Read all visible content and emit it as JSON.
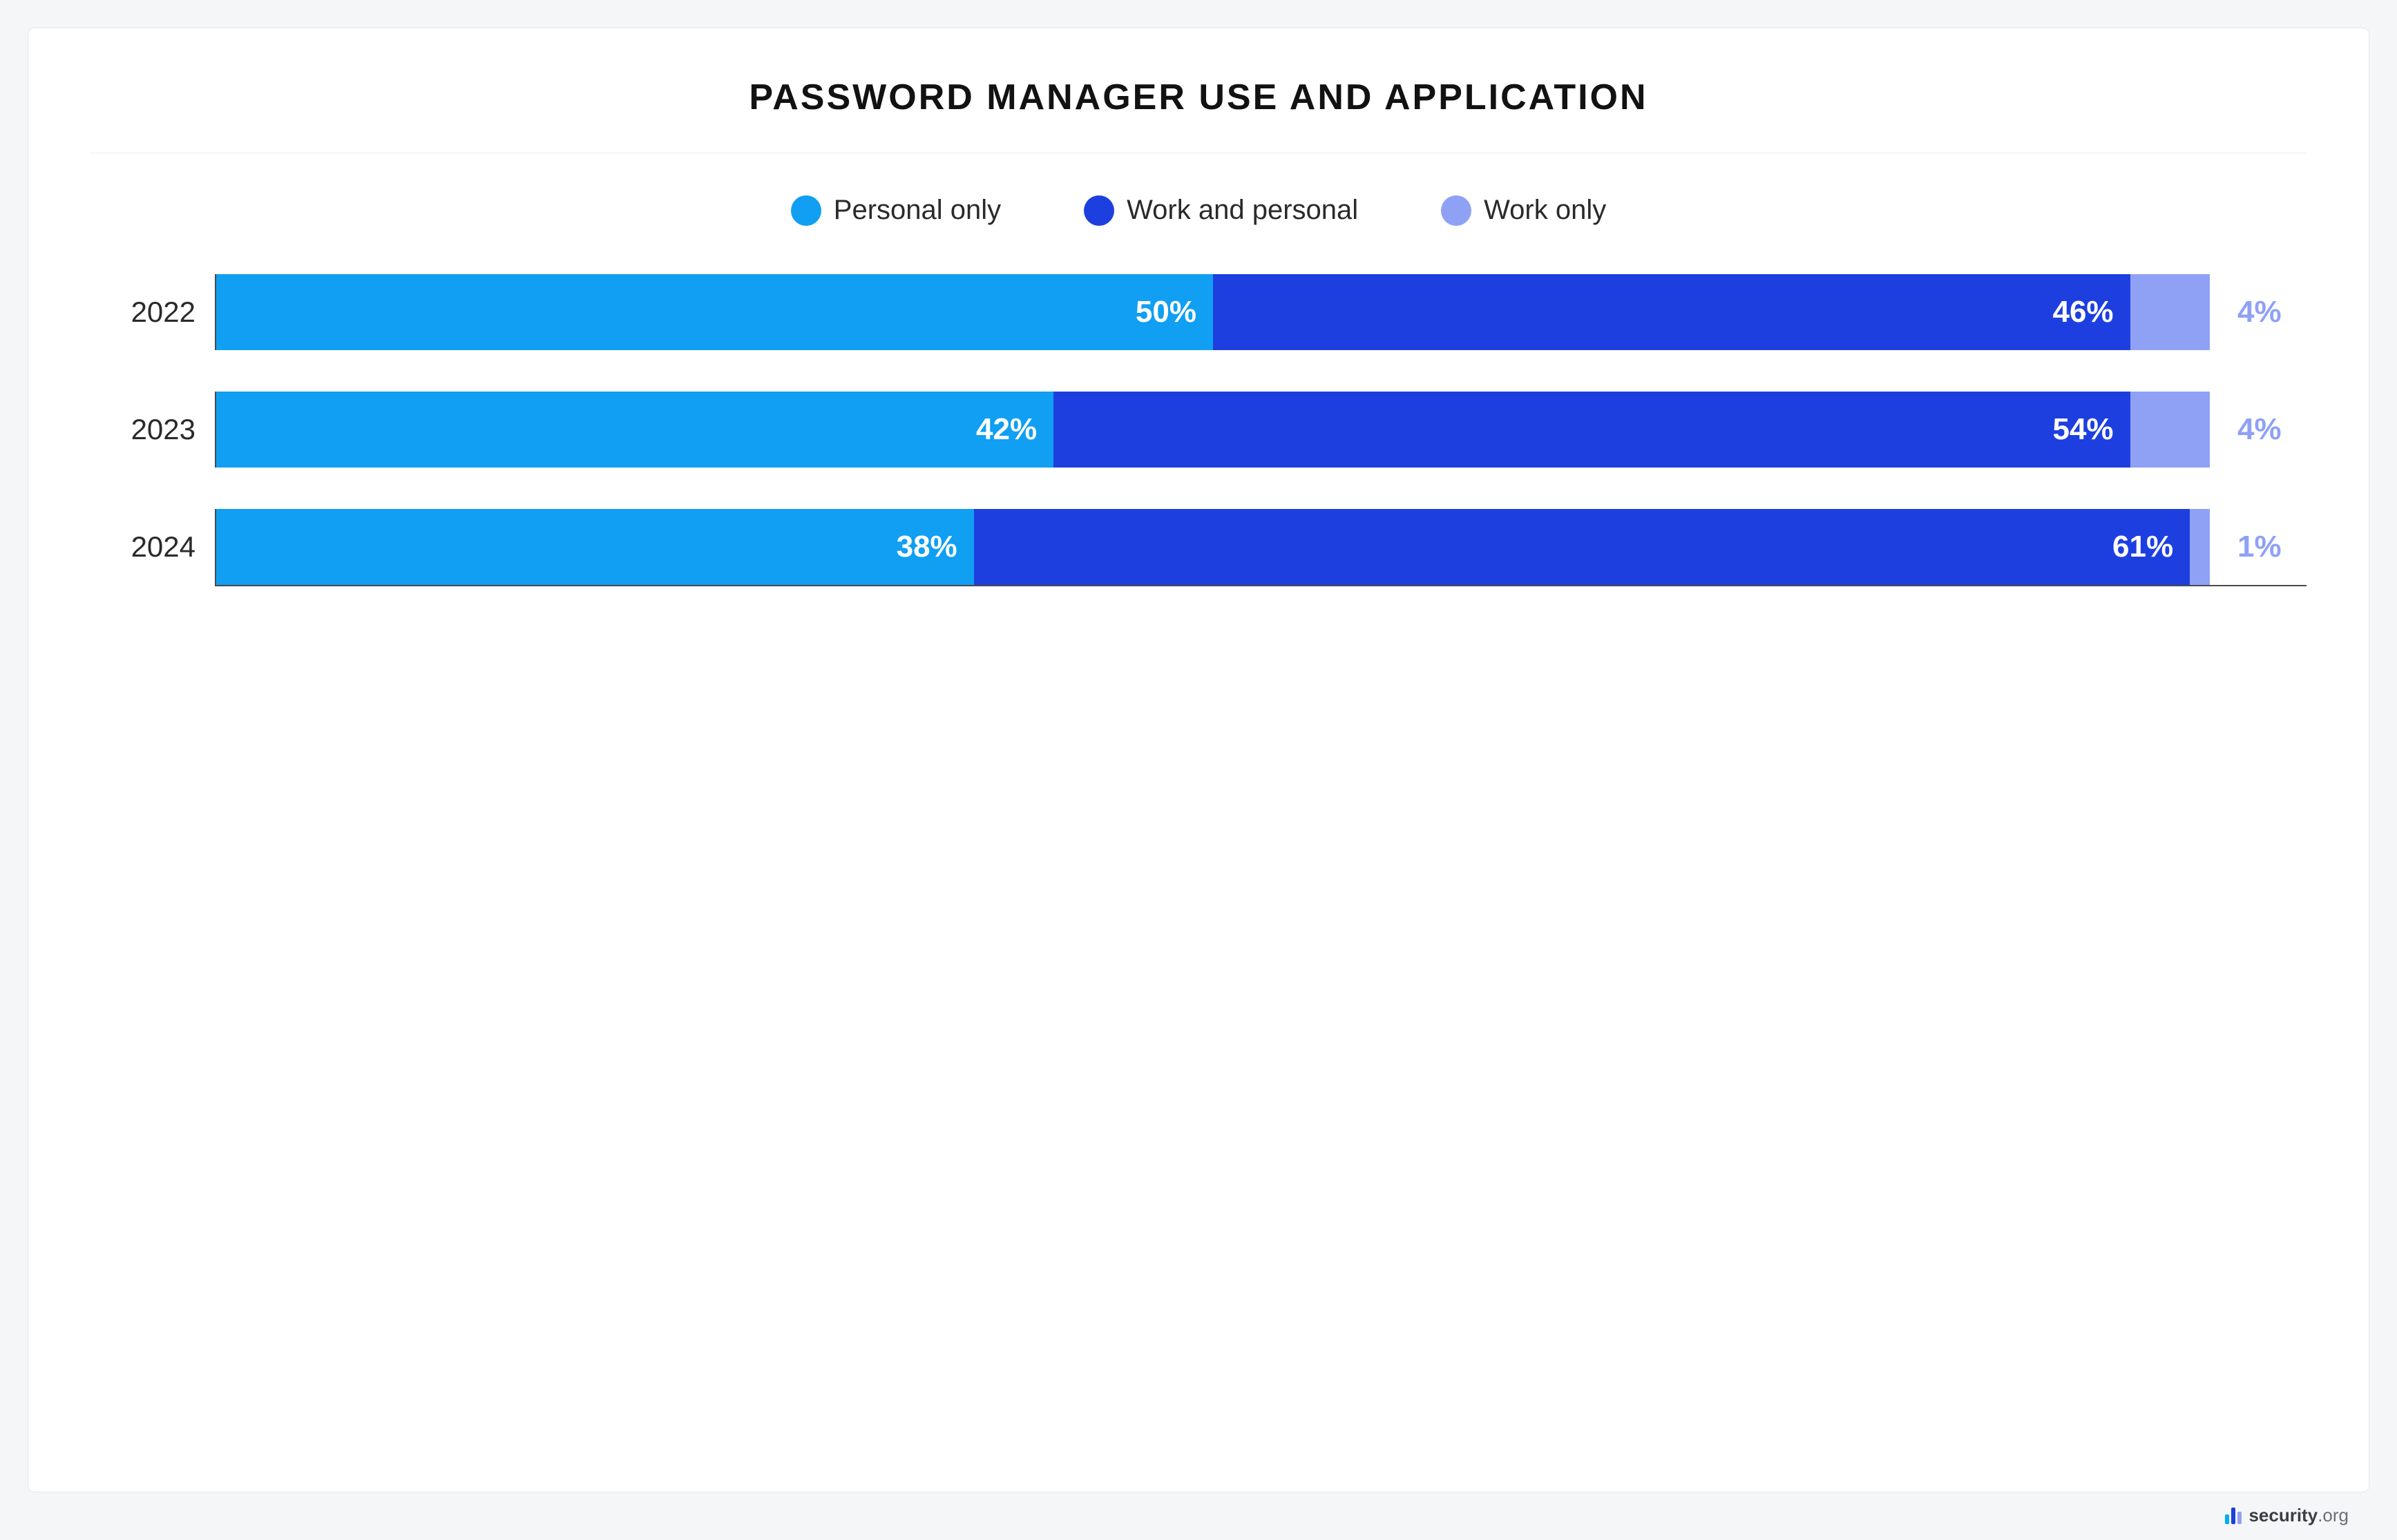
{
  "chart_data": {
    "type": "bar",
    "orientation": "horizontal-stacked",
    "title": "PASSWORD MANAGER USE AND APPLICATION",
    "categories": [
      "2022",
      "2023",
      "2024"
    ],
    "series": [
      {
        "name": "Personal only",
        "color": "#109ff2",
        "values": [
          50,
          42,
          38
        ]
      },
      {
        "name": "Work and personal",
        "color": "#1e3fe0",
        "values": [
          46,
          54,
          61
        ]
      },
      {
        "name": "Work only",
        "color": "#8fa1f5",
        "values": [
          4,
          4,
          1
        ]
      }
    ],
    "unit": "%",
    "xlim": [
      0,
      100
    ]
  },
  "attribution": {
    "brand": "security",
    "suffix": ".org"
  }
}
